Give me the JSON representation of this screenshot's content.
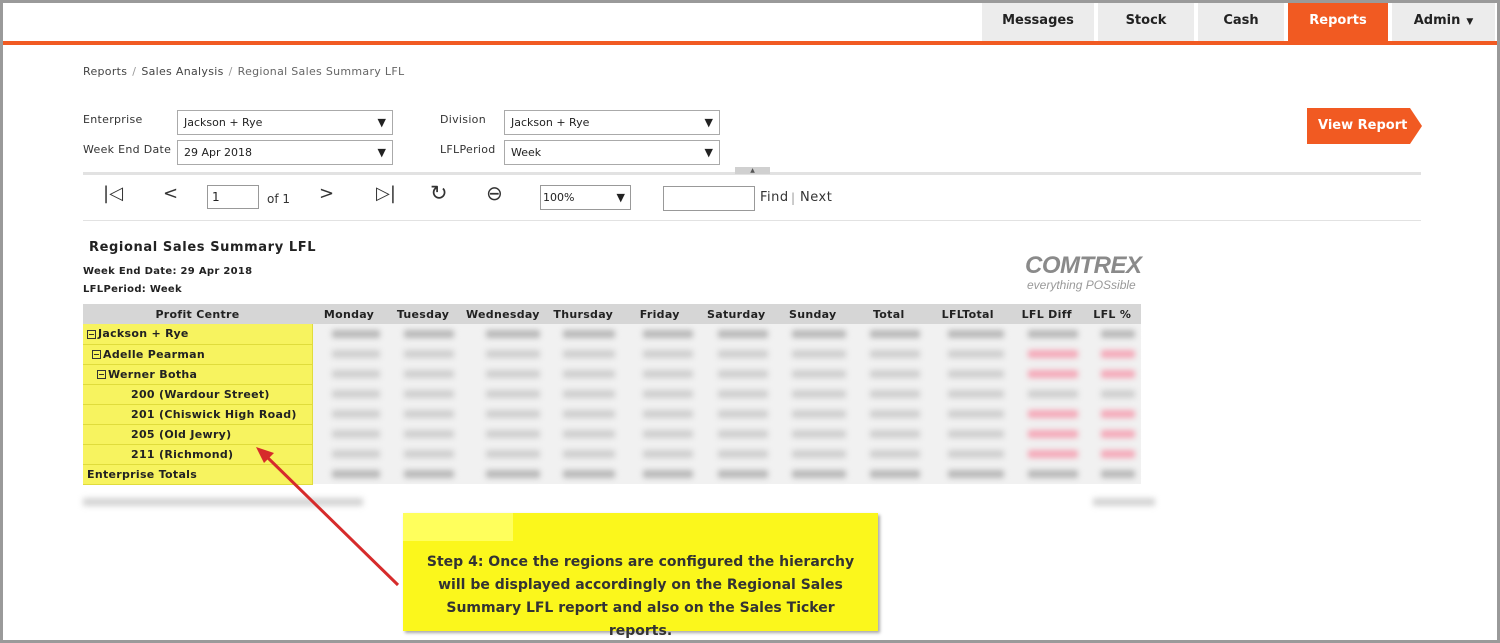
{
  "nav": {
    "messages": "Messages",
    "stock": "Stock",
    "cash": "Cash",
    "reports": "Reports",
    "admin": "Admin"
  },
  "breadcrumb": {
    "items": [
      "Reports",
      "Sales Analysis",
      "Regional Sales Summary LFL"
    ]
  },
  "filters": {
    "enterprise_label": "Enterprise",
    "enterprise_value": "Jackson + Rye",
    "division_label": "Division",
    "division_value": "Jackson + Rye",
    "weekend_label": "Week End Date",
    "weekend_value": "29 Apr 2018",
    "lflperiod_label": "LFLPeriod",
    "lflperiod_value": "Week",
    "view_report": "View Report"
  },
  "toolbar": {
    "page": "1",
    "of_label": "of 1",
    "zoom": "100%",
    "find_label": "Find",
    "next_label": "Next"
  },
  "report": {
    "title": "Regional Sales Summary LFL",
    "week_end": "Week End Date: 29 Apr 2018",
    "lfl_period": "LFLPeriod: Week",
    "logo_main": "COMTREX",
    "logo_tag": "everything POSsible",
    "columns": [
      "Profit Centre",
      "Monday",
      "Tuesday",
      "Wednesday",
      "Thursday",
      "Friday",
      "Saturday",
      "Sunday",
      "Total",
      "LFLTotal",
      "LFL Diff",
      "LFL %"
    ],
    "rows": [
      {
        "label": "Jackson + Rye",
        "level": 0,
        "toggle": "−"
      },
      {
        "label": "Adelle Pearman",
        "level": 1,
        "toggle": "−"
      },
      {
        "label": "Werner Botha",
        "level": 2,
        "toggle": "−"
      },
      {
        "label": "200 (Wardour Street)",
        "level": 3,
        "toggle": ""
      },
      {
        "label": "201 (Chiswick High Road)",
        "level": 3,
        "toggle": ""
      },
      {
        "label": "205 (Old Jewry)",
        "level": 3,
        "toggle": ""
      },
      {
        "label": "211 (Richmond)",
        "level": 3,
        "toggle": ""
      },
      {
        "label": "Enterprise Totals",
        "level": -1,
        "toggle": ""
      }
    ]
  },
  "callout": {
    "text": "Step 4: Once the regions are configured the hierarchy will be displayed accordingly on the Regional Sales Summary LFL report and also on the Sales Ticker reports."
  }
}
